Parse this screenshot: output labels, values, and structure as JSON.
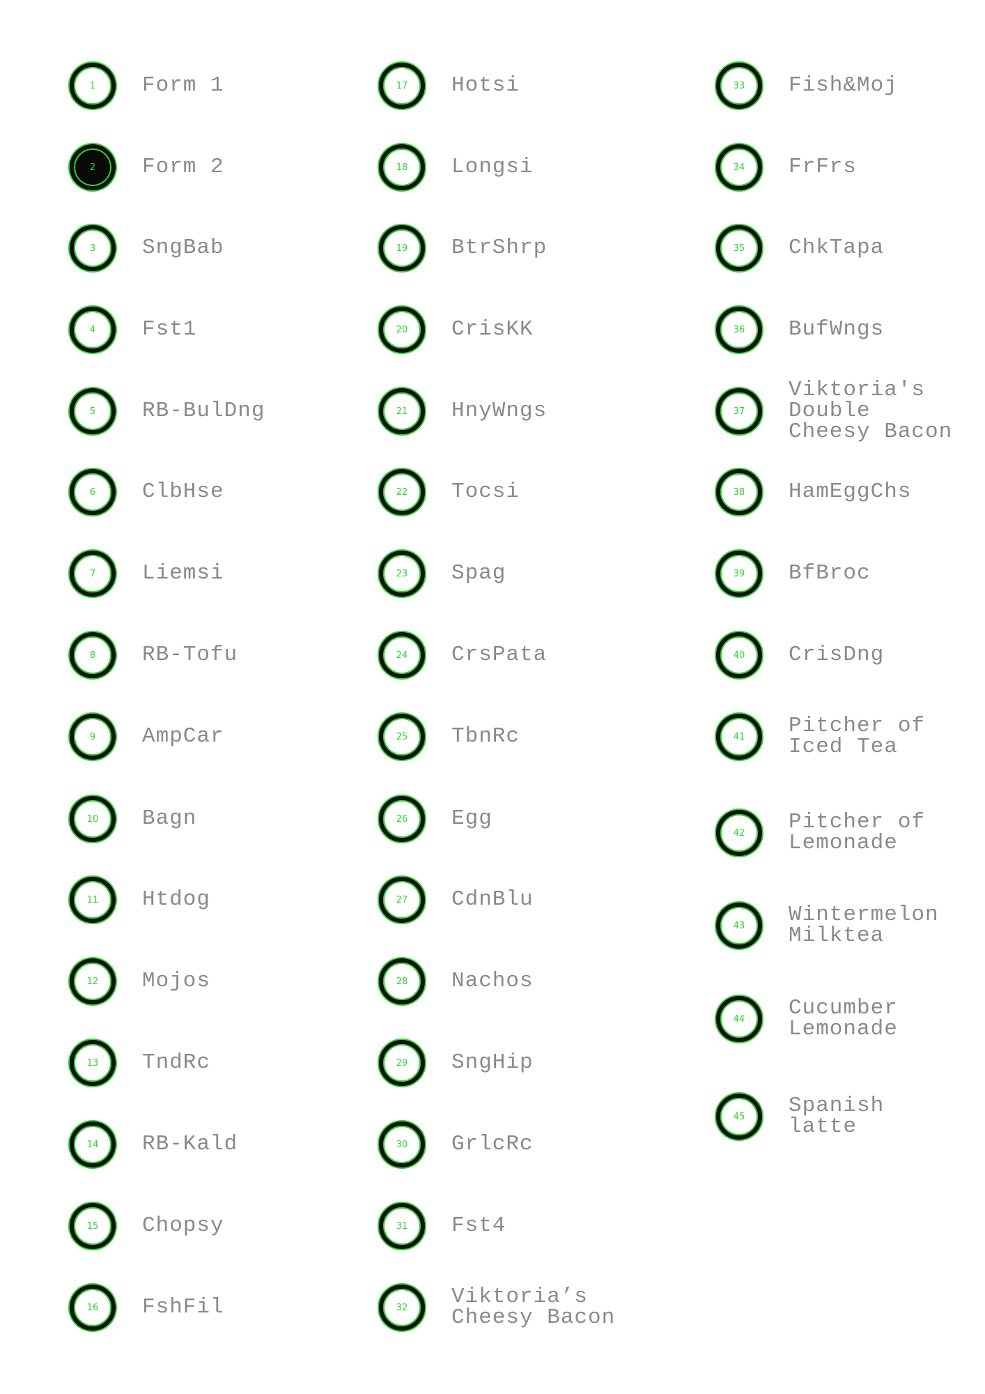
{
  "items": [
    {
      "number": "1",
      "label": "Form 1",
      "selected": false
    },
    {
      "number": "2",
      "label": "Form 2",
      "selected": true
    },
    {
      "number": "3",
      "label": "SngBab",
      "selected": false
    },
    {
      "number": "4",
      "label": "Fst1",
      "selected": false
    },
    {
      "number": "5",
      "label": "RB-BulDng",
      "selected": false
    },
    {
      "number": "6",
      "label": "ClbHse",
      "selected": false
    },
    {
      "number": "7",
      "label": "Liemsi",
      "selected": false
    },
    {
      "number": "8",
      "label": "RB-Tofu",
      "selected": false
    },
    {
      "number": "9",
      "label": "AmpCar",
      "selected": false
    },
    {
      "number": "10",
      "label": "Bagn",
      "selected": false
    },
    {
      "number": "11",
      "label": "Htdog",
      "selected": false
    },
    {
      "number": "12",
      "label": "Mojos",
      "selected": false
    },
    {
      "number": "13",
      "label": "TndRc",
      "selected": false
    },
    {
      "number": "14",
      "label": "RB-Kald",
      "selected": false
    },
    {
      "number": "15",
      "label": "Chopsy",
      "selected": false
    },
    {
      "number": "16",
      "label": "FshFil",
      "selected": false
    },
    {
      "number": "17",
      "label": "Hotsi",
      "selected": false
    },
    {
      "number": "18",
      "label": "Longsi",
      "selected": false
    },
    {
      "number": "19",
      "label": "BtrShrp",
      "selected": false
    },
    {
      "number": "20",
      "label": "CrisKK",
      "selected": false
    },
    {
      "number": "21",
      "label": "HnyWngs",
      "selected": false
    },
    {
      "number": "22",
      "label": "Tocsi",
      "selected": false
    },
    {
      "number": "23",
      "label": "Spag",
      "selected": false
    },
    {
      "number": "24",
      "label": "CrsPata",
      "selected": false
    },
    {
      "number": "25",
      "label": "TbnRc",
      "selected": false
    },
    {
      "number": "26",
      "label": "Egg",
      "selected": false
    },
    {
      "number": "27",
      "label": "CdnBlu",
      "selected": false
    },
    {
      "number": "28",
      "label": "Nachos",
      "selected": false
    },
    {
      "number": "29",
      "label": "SngHip",
      "selected": false
    },
    {
      "number": "30",
      "label": "GrlcRc",
      "selected": false
    },
    {
      "number": "31",
      "label": "Fst4",
      "selected": false
    },
    {
      "number": "32",
      "label": "Viktoria’s\nCheesy Bacon",
      "selected": false
    },
    {
      "number": "33",
      "label": "Fish&Moj",
      "selected": false
    },
    {
      "number": "34",
      "label": "FrFrs",
      "selected": false
    },
    {
      "number": "35",
      "label": "ChkTapa",
      "selected": false
    },
    {
      "number": "36",
      "label": "BufWngs",
      "selected": false
    },
    {
      "number": "37",
      "label": "Viktoria's\nDouble\nCheesy Bacon",
      "selected": false
    },
    {
      "number": "38",
      "label": "HamEggChs",
      "selected": false
    },
    {
      "number": "39",
      "label": "BfBroc",
      "selected": false
    },
    {
      "number": "40",
      "label": "CrisDng",
      "selected": false
    },
    {
      "number": "41",
      "label": "Pitcher of\nIced Tea",
      "selected": false
    },
    {
      "number": "42",
      "label": "Pitcher of\nLemonade",
      "selected": false
    },
    {
      "number": "43",
      "label": "Wintermelon\nMilktea",
      "selected": false
    },
    {
      "number": "44",
      "label": "Cucumber\nLemonade",
      "selected": false
    },
    {
      "number": "45",
      "label": "Spanish\nlatte",
      "selected": false
    }
  ],
  "colors": {
    "ring": "#111111",
    "accent_green": "#2fd42f",
    "label_gray": "#8a8a8a",
    "selected_fill": "#0a0a0a"
  }
}
